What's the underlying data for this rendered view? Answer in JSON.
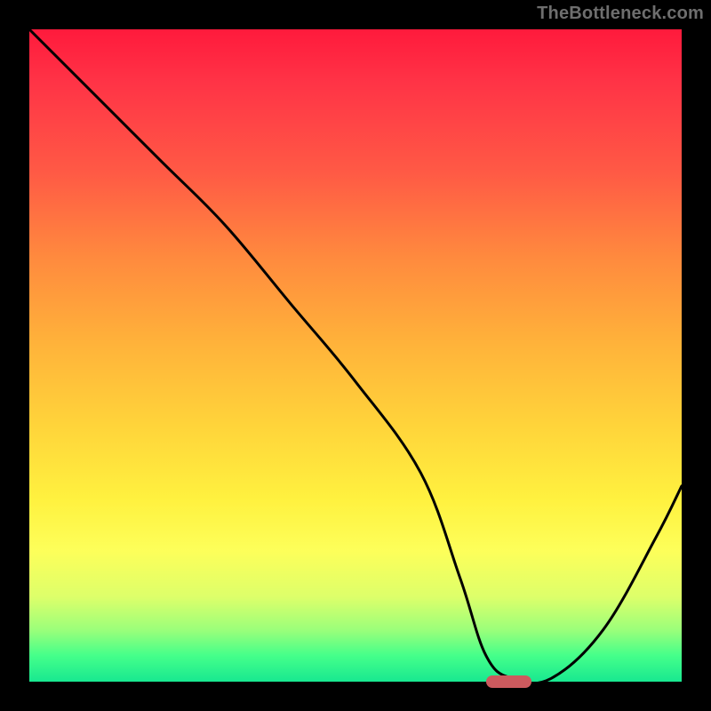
{
  "watermark": {
    "text": "TheBottleneck.com"
  },
  "colors": {
    "frame_background": "#000000",
    "gradient_top": "#ff1a3c",
    "gradient_mid": "#ffd23a",
    "gradient_bottom": "#18e890",
    "curve_stroke": "#000000",
    "marker_fill": "#cc5a5e",
    "watermark_text": "#6e6e6e"
  },
  "chart_data": {
    "type": "line",
    "title": "",
    "xlabel": "",
    "ylabel": "",
    "xlim": [
      0,
      100
    ],
    "ylim": [
      0,
      100
    ],
    "series": [
      {
        "name": "bottleneck-curve",
        "x": [
          0,
          8,
          20,
          30,
          40,
          50,
          60,
          66,
          70,
          74,
          80,
          88,
          96,
          100
        ],
        "values": [
          100,
          92,
          80,
          70,
          58,
          46,
          32,
          16,
          4,
          0.5,
          0.5,
          8,
          22,
          30
        ]
      }
    ],
    "marker": {
      "name": "optimal-range",
      "x_start": 70,
      "x_end": 77,
      "y": 0
    },
    "grid": false,
    "legend": false
  }
}
